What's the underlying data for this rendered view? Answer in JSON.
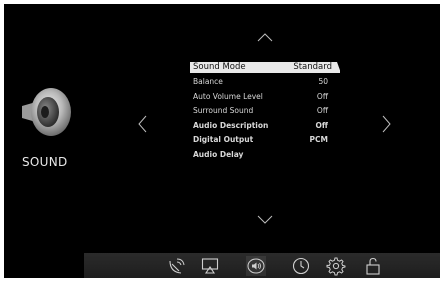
{
  "section": {
    "title": "SOUND",
    "icon": "speaker-icon"
  },
  "navigation": [
    "up-arrow",
    "down-arrow",
    "left-arrow",
    "right-arrow"
  ],
  "menu": {
    "items": [
      {
        "label": "Sound Mode",
        "value": "Standard",
        "selected": true,
        "bold": false
      },
      {
        "label": "Balance",
        "value": "50",
        "selected": false,
        "bold": false
      },
      {
        "label": "Auto Volume Level",
        "value": "Off",
        "selected": false,
        "bold": false
      },
      {
        "label": "Surround Sound",
        "value": "Off",
        "selected": false,
        "bold": false
      },
      {
        "label": "Audio Description",
        "value": "Off",
        "selected": false,
        "bold": true
      },
      {
        "label": "Digital Output",
        "value": "PCM",
        "selected": false,
        "bold": true
      },
      {
        "label": "Audio Delay",
        "value": "",
        "selected": false,
        "bold": true
      }
    ]
  },
  "bottom_bar": {
    "icons": [
      "satellite-icon",
      "screen-icon",
      "sound-icon",
      "clock-icon",
      "settings-icon",
      "lock-icon"
    ],
    "active": "sound-icon"
  },
  "colors": {
    "background": "#000000",
    "highlight": "#e9e9e9",
    "text": "#d8d8d8"
  }
}
